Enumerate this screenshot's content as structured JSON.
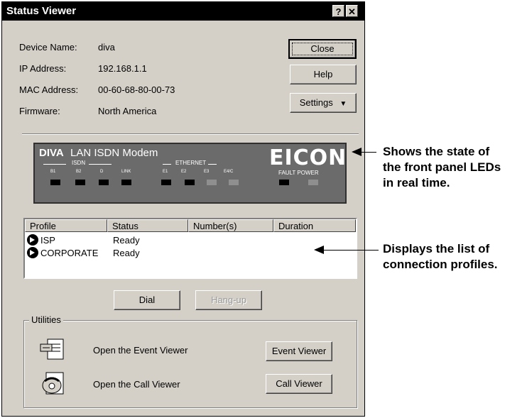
{
  "window": {
    "title": "Status Viewer",
    "help_btn": "?",
    "close_btn": "✕"
  },
  "info": [
    {
      "label": "Device Name:",
      "value": "diva"
    },
    {
      "label": "IP Address:",
      "value": "192.168.1.1"
    },
    {
      "label": "MAC Address:",
      "value": "00-60-68-80-00-73"
    },
    {
      "label": "Firmware:",
      "value": "North America"
    }
  ],
  "buttons": {
    "close": "Close",
    "help": "Help",
    "settings": "Settings",
    "settings_arrow": "▼",
    "dial": "Dial",
    "hangup": "Hang-up"
  },
  "front_panel": {
    "model": "DIVA",
    "model_rest": "LAN ISDN Modem",
    "isdn_group": "ISDN",
    "ethernet_group": "ETHERNET",
    "brand": "EICON",
    "led_labels": [
      "B1",
      "B2",
      "D",
      "LINK",
      "E1",
      "E2",
      "E3",
      "E4/C",
      "FAULT",
      "POWER"
    ],
    "fault_power": "FAULT POWER",
    "led_states": [
      "off",
      "off",
      "off",
      "off",
      "off",
      "off",
      "dim",
      "dim",
      "off",
      "dim"
    ]
  },
  "profiles": {
    "columns": [
      "Profile",
      "Status",
      "Number(s)",
      "Duration"
    ],
    "rows": [
      {
        "profile": "ISP",
        "status": "Ready",
        "numbers": "",
        "duration": ""
      },
      {
        "profile": "CORPORATE",
        "status": "Ready",
        "numbers": "",
        "duration": ""
      }
    ]
  },
  "utilities": {
    "title": "Utilities",
    "event_text": "Open the Event Viewer",
    "event_btn": "Event Viewer",
    "call_text": "Open the Call Viewer",
    "call_btn": "Call Viewer"
  },
  "annotations": {
    "leds": [
      "Shows the state of",
      "the front panel LEDs",
      "in real time."
    ],
    "profiles": [
      "Displays the list of",
      "connection profiles."
    ]
  }
}
